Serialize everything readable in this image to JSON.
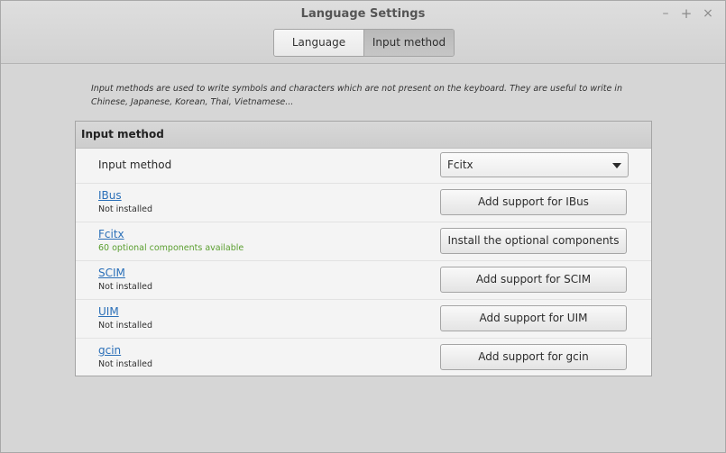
{
  "window": {
    "title": "Language Settings",
    "controls": {
      "minimize": "–",
      "maximize": "+",
      "close": "×"
    }
  },
  "tabs": [
    {
      "label": "Language",
      "active": false
    },
    {
      "label": "Input method",
      "active": true
    }
  ],
  "description": "Input methods are used to write symbols and characters which are not present on the keyboard. They are useful to write in Chinese, Japanese, Korean, Thai, Vietnamese...",
  "frame": {
    "title": "Input method",
    "selector": {
      "label": "Input method",
      "value": "Fcitx"
    },
    "methods": [
      {
        "name": "IBus",
        "status": "Not installed",
        "button": "Add support for IBus"
      },
      {
        "name": "Fcitx",
        "status": "60 optional components available",
        "button": "Install the optional components"
      },
      {
        "name": "SCIM",
        "status": "Not installed",
        "button": "Add support for SCIM"
      },
      {
        "name": "UIM",
        "status": "Not installed",
        "button": "Add support for UIM"
      },
      {
        "name": "gcin",
        "status": "Not installed",
        "button": "Add support for gcin"
      }
    ]
  },
  "colors": {
    "link": "#2a6fb8",
    "status_available": "#5a9e2f",
    "active_tab": "#bfbfbf"
  }
}
